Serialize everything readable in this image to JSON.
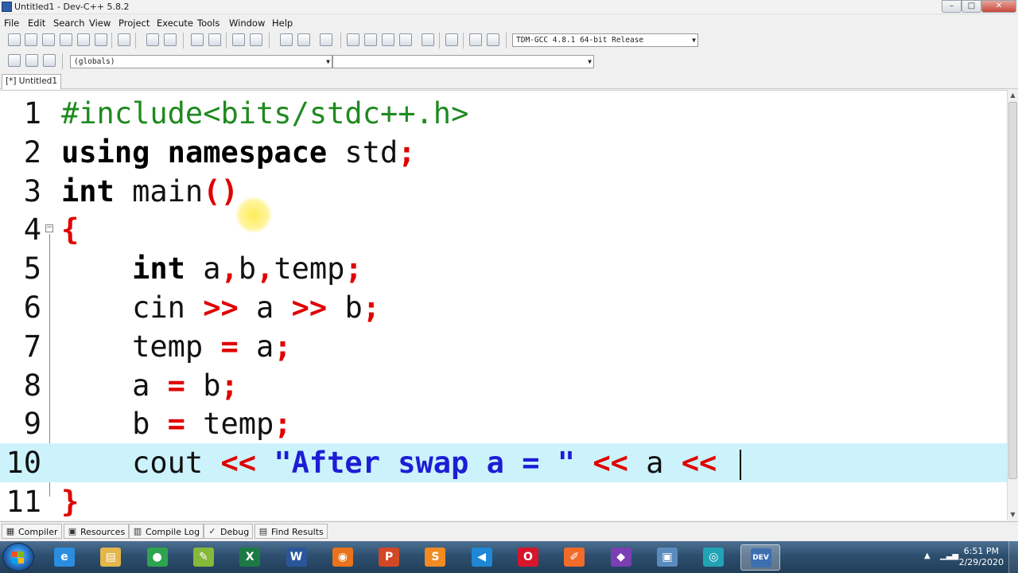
{
  "window": {
    "title": "Untitled1 - Dev-C++ 5.8.2",
    "controls": {
      "minimize": "–",
      "maximize": "□",
      "close": "✕"
    }
  },
  "menu": [
    "File",
    "Edit",
    "Search",
    "View",
    "Project",
    "Execute",
    "Tools",
    "Window",
    "Help"
  ],
  "toolbar": {
    "compiler_select": "TDM-GCC 4.8.1 64-bit Release",
    "scope_select": "(globals)",
    "member_select": "",
    "icons": [
      "new-file-icon",
      "new-project-icon",
      "save-icon",
      "save-all-icon",
      "close-icon",
      "close-all-icon",
      "print-icon",
      "undo-icon",
      "redo-icon",
      "find-icon",
      "replace-icon",
      "indent-icon",
      "unindent-icon",
      "goto-back-icon",
      "goto-forward-icon",
      "toggle-bookmark-icon",
      "compile-icon",
      "run-icon",
      "compile-run-icon",
      "rebuild-icon",
      "syntax-check-icon",
      "stop-icon",
      "chart-icon",
      "debug-icon"
    ]
  },
  "tabs": [
    "[*] Untitled1"
  ],
  "editor": {
    "active_line": 10,
    "lines": [
      {
        "num": "1",
        "segments": [
          {
            "t": "#include<bits/stdc++.h>",
            "c": "pre"
          }
        ]
      },
      {
        "num": "2",
        "segments": [
          {
            "t": "using",
            "c": "kw"
          },
          {
            "t": " "
          },
          {
            "t": "namespace",
            "c": "kw"
          },
          {
            "t": " std"
          },
          {
            "t": ";",
            "c": "op"
          }
        ]
      },
      {
        "num": "3",
        "segments": [
          {
            "t": "int",
            "c": "kw"
          },
          {
            "t": " main"
          },
          {
            "t": "()",
            "c": "op"
          }
        ]
      },
      {
        "num": "4",
        "segments": [
          {
            "t": "{",
            "c": "op"
          }
        ]
      },
      {
        "num": "5",
        "segments": [
          {
            "t": "    "
          },
          {
            "t": "int",
            "c": "kw"
          },
          {
            "t": " a"
          },
          {
            "t": ",",
            "c": "op"
          },
          {
            "t": "b"
          },
          {
            "t": ",",
            "c": "op"
          },
          {
            "t": "temp"
          },
          {
            "t": ";",
            "c": "op"
          }
        ]
      },
      {
        "num": "6",
        "segments": [
          {
            "t": "    cin "
          },
          {
            "t": ">>",
            "c": "op"
          },
          {
            "t": " a "
          },
          {
            "t": ">>",
            "c": "op"
          },
          {
            "t": " b"
          },
          {
            "t": ";",
            "c": "op"
          }
        ]
      },
      {
        "num": "7",
        "segments": [
          {
            "t": "    temp "
          },
          {
            "t": "=",
            "c": "op"
          },
          {
            "t": " a"
          },
          {
            "t": ";",
            "c": "op"
          }
        ]
      },
      {
        "num": "8",
        "segments": [
          {
            "t": "    a "
          },
          {
            "t": "=",
            "c": "op"
          },
          {
            "t": " b"
          },
          {
            "t": ";",
            "c": "op"
          }
        ]
      },
      {
        "num": "9",
        "segments": [
          {
            "t": "    b "
          },
          {
            "t": "=",
            "c": "op"
          },
          {
            "t": " temp"
          },
          {
            "t": ";",
            "c": "op"
          }
        ]
      },
      {
        "num": "10",
        "segments": [
          {
            "t": "    cout "
          },
          {
            "t": "<<",
            "c": "op"
          },
          {
            "t": " "
          },
          {
            "t": "\"After swap a = \"",
            "c": "str"
          },
          {
            "t": " "
          },
          {
            "t": "<<",
            "c": "op"
          },
          {
            "t": " a "
          },
          {
            "t": "<<",
            "c": "op"
          },
          {
            "t": " "
          }
        ]
      },
      {
        "num": "11",
        "segments": [
          {
            "t": "}",
            "c": "op"
          }
        ]
      }
    ]
  },
  "bottom_tabs": [
    {
      "label": "Compiler",
      "icon": "compiler-grid-icon"
    },
    {
      "label": "Resources",
      "icon": "resources-icon"
    },
    {
      "label": "Compile Log",
      "icon": "compile-log-icon"
    },
    {
      "label": "Debug",
      "icon": "debug-check-icon"
    },
    {
      "label": "Find Results",
      "icon": "find-results-icon"
    }
  ],
  "taskbar": {
    "apps": [
      {
        "name": "internet-explorer",
        "glyph": "e",
        "color": "#2b8de0"
      },
      {
        "name": "file-explorer",
        "glyph": "▤",
        "color": "#e3b54a"
      },
      {
        "name": "chrome",
        "glyph": "●",
        "color": "#2ea44f"
      },
      {
        "name": "notepad-plus-plus",
        "glyph": "✎",
        "color": "#86b83a"
      },
      {
        "name": "excel",
        "glyph": "X",
        "color": "#1d7a45"
      },
      {
        "name": "word",
        "glyph": "W",
        "color": "#2b579a"
      },
      {
        "name": "firefox",
        "glyph": "◉",
        "color": "#e8731c"
      },
      {
        "name": "powerpoint",
        "glyph": "P",
        "color": "#d24726"
      },
      {
        "name": "sublime-text",
        "glyph": "S",
        "color": "#f18b23"
      },
      {
        "name": "vs-code",
        "glyph": "◀",
        "color": "#1e88d6"
      },
      {
        "name": "opera",
        "glyph": "O",
        "color": "#d6162c"
      },
      {
        "name": "tool-orange",
        "glyph": "✐",
        "color": "#f26b2a"
      },
      {
        "name": "visual-studio",
        "glyph": "◆",
        "color": "#7b3fb4"
      },
      {
        "name": "network-app",
        "glyph": "▣",
        "color": "#5a8bbf"
      },
      {
        "name": "camera-app",
        "glyph": "◎",
        "color": "#22a3b5"
      },
      {
        "name": "dev-cpp",
        "glyph": "DEV",
        "color": "#3c6fb0"
      }
    ],
    "active_app": "dev-cpp",
    "time": "6:51 PM",
    "date": "2/29/2020"
  }
}
